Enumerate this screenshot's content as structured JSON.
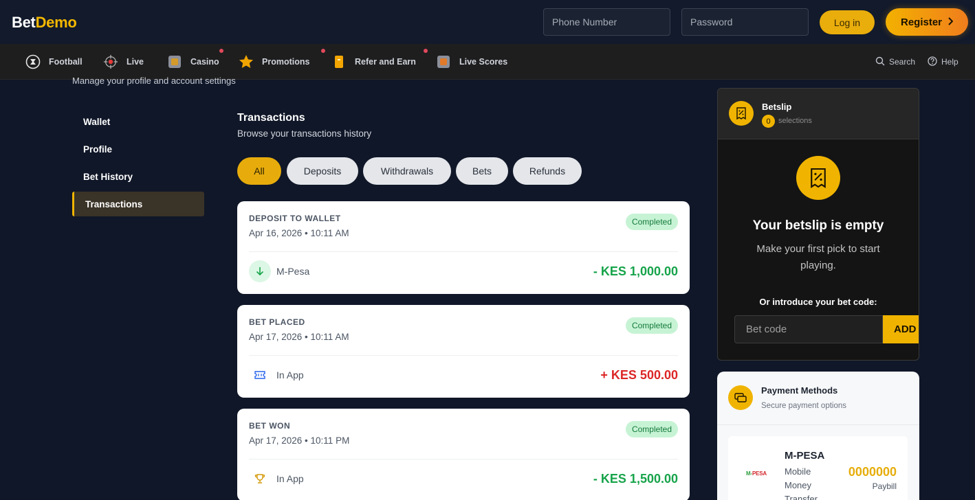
{
  "header": {
    "logo_part1": "Bet",
    "logo_part2": "Demo",
    "phone_placeholder": "Phone Number",
    "password_placeholder": "Password",
    "login_label": "Log in",
    "register_label": "Register"
  },
  "nav": {
    "items": [
      {
        "label": "Football",
        "icon": "football-icon"
      },
      {
        "label": "Live",
        "icon": "live-icon"
      },
      {
        "label": "Casino",
        "icon": "casino-icon"
      },
      {
        "label": "Promotions",
        "icon": "promotions-icon"
      },
      {
        "label": "Refer and Earn",
        "icon": "refer-icon"
      },
      {
        "label": "Live Scores",
        "icon": "live-scores-icon"
      }
    ],
    "search_label": "Search",
    "help_label": "Help"
  },
  "page": {
    "subtitle": "Manage your profile and account settings"
  },
  "sidebar": {
    "items": [
      {
        "label": "Wallet"
      },
      {
        "label": "Profile"
      },
      {
        "label": "Bet History"
      },
      {
        "label": "Transactions"
      }
    ]
  },
  "transactions": {
    "title": "Transactions",
    "subtitle": "Browse your transactions history",
    "filters": [
      "All",
      "Deposits",
      "Withdrawals",
      "Bets",
      "Refunds"
    ],
    "items": [
      {
        "type": "DEPOSIT TO WALLET",
        "date": "Apr 16, 2026 • 10:11 AM",
        "status": "Completed",
        "method": "M-Pesa",
        "amount": "- KES 1,000.00"
      },
      {
        "type": "BET PLACED",
        "date": "Apr 17, 2026 • 10:11 AM",
        "status": "Completed",
        "method": "In App",
        "amount": "+ KES 500.00"
      },
      {
        "type": "BET WON",
        "date": "Apr 17, 2026 • 10:11 PM",
        "status": "Completed",
        "method": "In App",
        "amount": "- KES 1,500.00"
      }
    ]
  },
  "betslip": {
    "title": "Betslip",
    "count": "0",
    "selections_label": "selections",
    "empty_title": "Your betslip is empty",
    "empty_sub": "Make your first pick to start playing.",
    "code_label": "Or introduce your bet code:",
    "code_placeholder": "Bet code",
    "add_label": "ADD"
  },
  "payment": {
    "title": "Payment Methods",
    "subtitle": "Secure payment options",
    "method_name": "M-PESA",
    "method_desc": "Mobile Money Transfer",
    "paybill_number": "0000000",
    "paybill_label": "Paybill",
    "logo_text_1": "M-",
    "logo_text_2": "PESA"
  },
  "colors": {
    "accent": "#f0b400",
    "background": "#101728",
    "success": "#16a34a",
    "danger": "#dc2626"
  }
}
